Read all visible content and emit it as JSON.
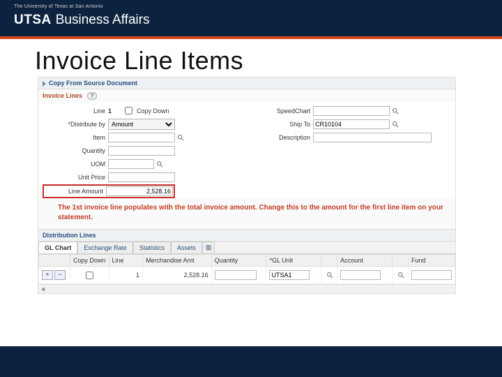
{
  "brand": {
    "university": "The University of Texas at San Antonio",
    "logo": "UTSA",
    "dept": "Business Affairs"
  },
  "slide": {
    "title": "Invoice Line Items"
  },
  "copyFrom": {
    "label": "Copy From Source Document"
  },
  "invoiceLines": {
    "header": "Invoice Lines",
    "help": "?",
    "left": {
      "line_lbl": "Line",
      "line_val": "1",
      "copy_down_lbl": "Copy Down",
      "distribute_lbl": "Distribute by",
      "distribute_val": "Amount",
      "item_lbl": "Item",
      "item_val": "",
      "quantity_lbl": "Quantity",
      "quantity_val": "",
      "uom_lbl": "UOM",
      "uom_val": "",
      "unit_price_lbl": "Unit Price",
      "unit_price_val": "",
      "line_amount_lbl": "Line Amount",
      "line_amount_val": "2,528.16"
    },
    "right": {
      "speedchart_lbl": "SpeedChart",
      "speedchart_val": "",
      "ship_to_lbl": "Ship To",
      "ship_to_val": "CR10104",
      "description_lbl": "Description",
      "description_val": ""
    },
    "note": "The 1st invoice line populates with the total invoice amount. Change this to the amount for the first line item on your statement."
  },
  "distribution": {
    "header": "Distribution Lines",
    "tabs": [
      "GL Chart",
      "Exchange Rate",
      "Statistics",
      "Assets"
    ],
    "columns": [
      "",
      "Copy Down",
      "Line",
      "Merchandise Amt",
      "Quantity",
      "*GL Unit",
      "",
      "Account",
      "",
      "Fund"
    ],
    "row": {
      "line": "1",
      "merch_amt": "2,528.16",
      "quantity": "",
      "gl_unit": "UTSA1",
      "account": "",
      "fund": ""
    }
  }
}
